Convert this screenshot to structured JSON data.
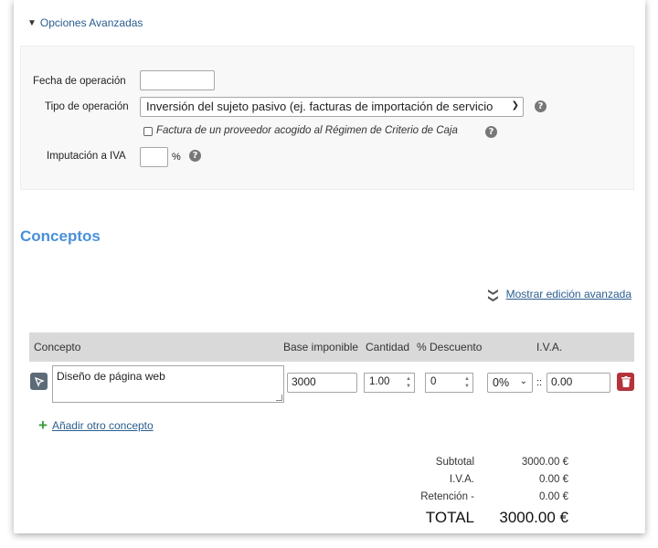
{
  "advanced": {
    "toggle_label": "Opciones Avanzadas",
    "fecha": {
      "label": "Fecha de operación",
      "value": ""
    },
    "tipo": {
      "label": "Tipo de operación",
      "selected": "Inversión del sujeto pasivo (ej. facturas de importación de servicio"
    },
    "criterio_caja": {
      "label": "Factura de un proveedor acogido al Régimen de Criterio de Caja",
      "checked": false
    },
    "imputacion": {
      "label": "Imputación a IVA",
      "value": "",
      "unit": "%"
    },
    "help_glyph": "?"
  },
  "conceptos": {
    "title": "Conceptos",
    "advanced_edit_link": "Mostrar edición avanzada",
    "columns": {
      "concepto": "Concepto",
      "base": "Base imponible",
      "cantidad": "Cantidad",
      "descuento": "% Descuento",
      "iva": "I.V.A."
    },
    "rows": [
      {
        "concepto": "Diseño de página web",
        "base": "3000",
        "cantidad": "1.00",
        "descuento": "0",
        "iva_rate": "0%",
        "iva_sep": "::",
        "iva_amount": "0.00"
      }
    ],
    "add_link": "Añadir otro concepto"
  },
  "totals": {
    "subtotal_label": "Subtotal",
    "subtotal_value": "3000.00 €",
    "iva_label": "I.V.A.",
    "iva_value": "0.00 €",
    "retencion_label": "Retención -",
    "retencion_value": "0.00 €",
    "total_label": "TOTAL",
    "total_value": "3000.00 €"
  },
  "colors": {
    "accent": "#4a90d9",
    "link": "#2a5d8f",
    "add_icon": "#3e9b3e",
    "delete_button": "#b5333a"
  }
}
